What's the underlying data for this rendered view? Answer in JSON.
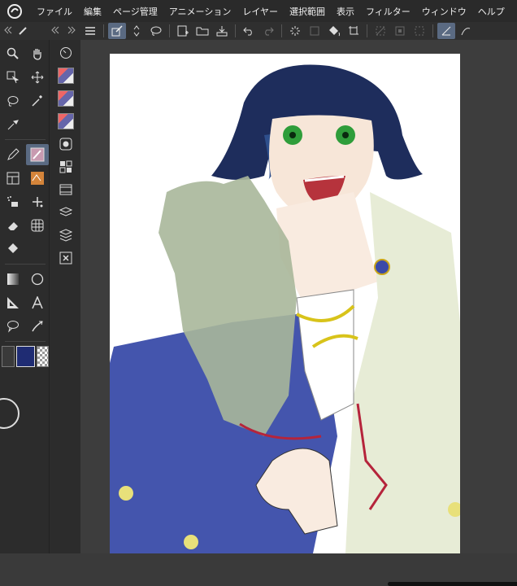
{
  "menu": {
    "items": [
      "ファイル",
      "編集",
      "ページ管理",
      "アニメーション",
      "レイヤー",
      "選択範囲",
      "表示",
      "フィルター",
      "ウィンドウ",
      "ヘルプ"
    ]
  },
  "colors": {
    "main_color": "#1f2c73",
    "sub_color": "#c8c8c8",
    "selection_accent": "#5a6a82"
  }
}
